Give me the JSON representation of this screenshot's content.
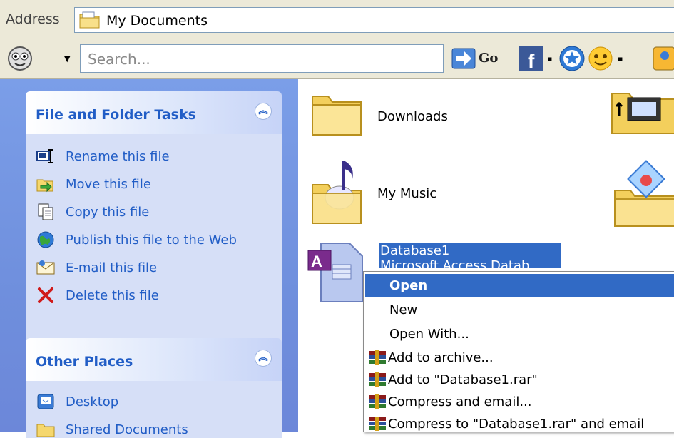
{
  "address": {
    "label": "Address",
    "value": "My Documents",
    "icon": "my-documents-folder-icon"
  },
  "toolbar": {
    "search_placeholder": "Search...",
    "go_label": "Go",
    "icons": [
      "smiley-icon",
      "go-arrow-icon",
      "facebook-icon",
      "star-icon",
      "smiley-face-icon",
      "partial-icon"
    ]
  },
  "tasks_panel": {
    "title": "File and Folder Tasks",
    "items": [
      {
        "label": "Rename this file",
        "icon": "rename-icon"
      },
      {
        "label": "Move this file",
        "icon": "move-icon"
      },
      {
        "label": "Copy this file",
        "icon": "copy-icon"
      },
      {
        "label": "Publish this file to the Web",
        "icon": "publish-globe-icon"
      },
      {
        "label": "E-mail this file",
        "icon": "email-icon"
      },
      {
        "label": "Delete this file",
        "icon": "delete-x-icon"
      }
    ]
  },
  "places_panel": {
    "title": "Other Places",
    "items": [
      {
        "label": "Desktop",
        "icon": "desktop-icon"
      },
      {
        "label": "Shared Documents",
        "icon": "shared-folder-icon"
      }
    ]
  },
  "files": [
    {
      "name": "Downloads",
      "icon": "folder-icon"
    },
    {
      "name": "My Music",
      "icon": "music-folder-icon"
    },
    {
      "name": "Database1",
      "subtitle": "Microsoft Access Datab",
      "icon": "access-database-icon",
      "selected": true
    }
  ],
  "context_menu": {
    "items": [
      {
        "label": "Open",
        "active": true
      },
      {
        "label": "New"
      },
      {
        "label": "Open With..."
      },
      {
        "label": "Add to archive...",
        "icon": "winrar-icon"
      },
      {
        "label": "Add to \"Database1.rar\"",
        "icon": "winrar-icon"
      },
      {
        "label": "Compress and email...",
        "icon": "winrar-icon"
      },
      {
        "label": "Compress to \"Database1.rar\" and email",
        "icon": "winrar-icon"
      }
    ]
  },
  "colors": {
    "task_link": "#215dc6",
    "selection": "#316ac5",
    "pane_bg": "#7b9ee8"
  }
}
